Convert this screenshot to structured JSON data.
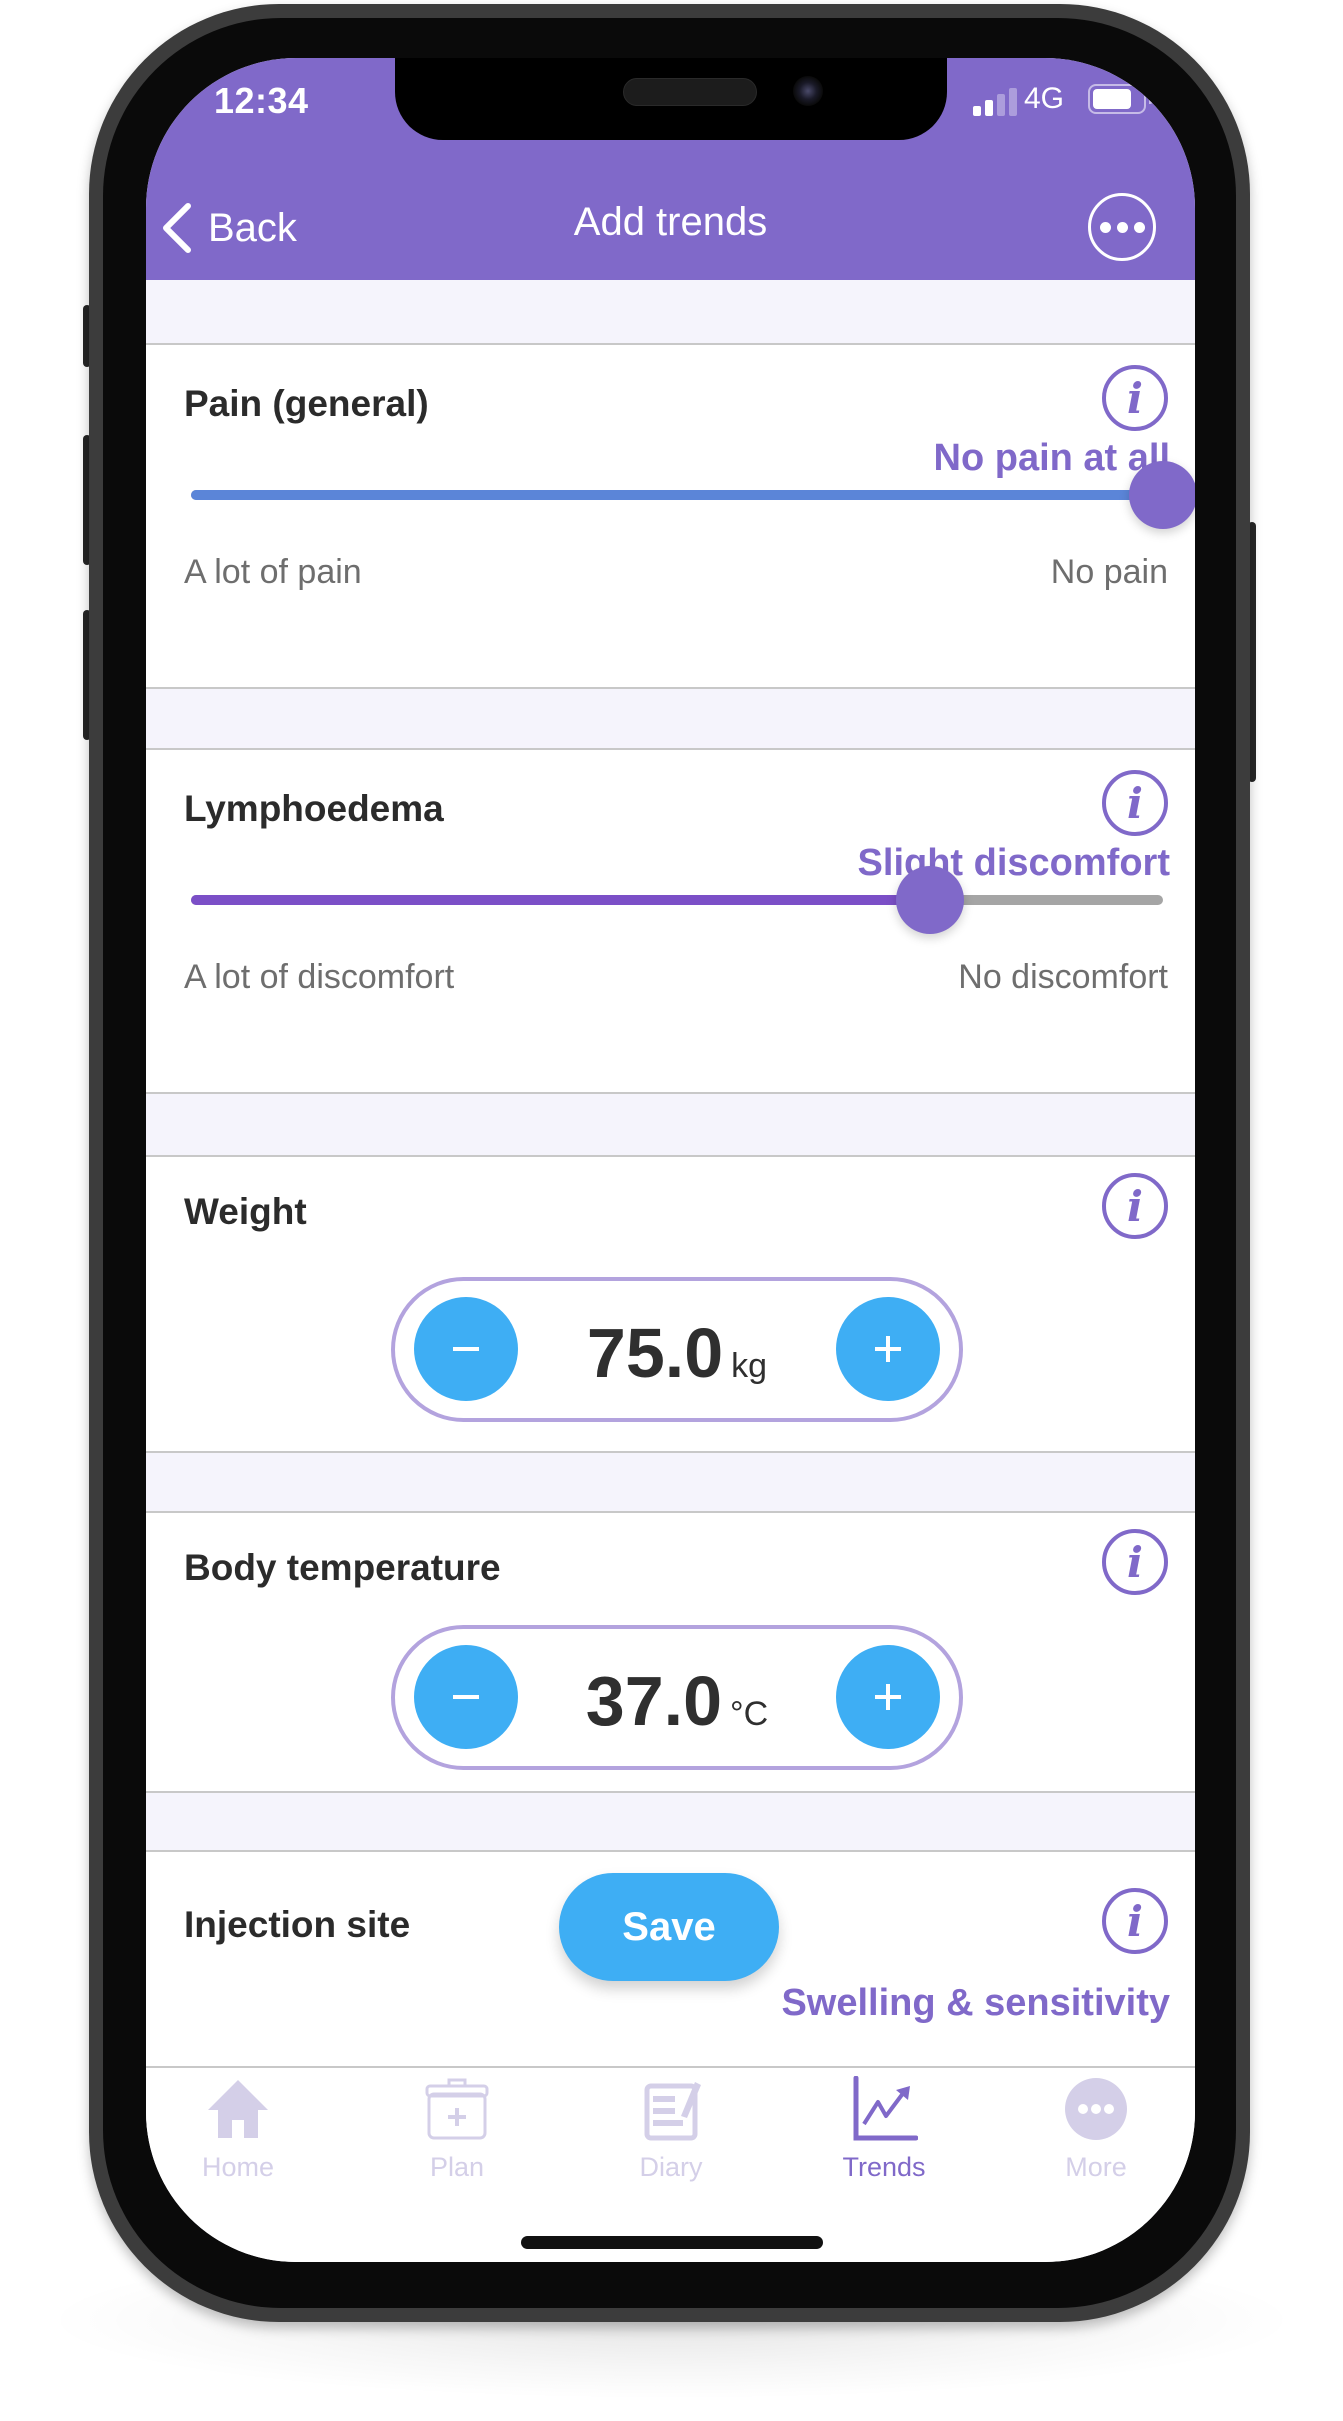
{
  "status_bar": {
    "time": "12:34",
    "network": "4G",
    "signal_bars_active": 2,
    "signal_bars_total": 4,
    "battery_level": 0.8
  },
  "nav": {
    "back_label": "Back",
    "title": "Add trends",
    "more_icon": "ellipsis-circle-icon"
  },
  "colors": {
    "brand_purple": "#8069c9",
    "accent_blue": "#3eaef4",
    "slider_blue": "#5b85d8",
    "slider_purple": "#7b4fc7",
    "inactive_tab": "#d4cfe8"
  },
  "trends": [
    {
      "title": "Pain (general)",
      "type": "slider",
      "value_label": "No pain at all",
      "min_label": "A lot of pain",
      "max_label": "No pain",
      "value_fraction": 1.0
    },
    {
      "title": "Lymphoedema",
      "type": "slider",
      "value_label": "Slight discomfort",
      "min_label": "A lot of discomfort",
      "max_label": "No discomfort",
      "value_fraction": 0.76
    },
    {
      "title": "Weight",
      "type": "stepper",
      "value": "75.0",
      "unit": "kg"
    },
    {
      "title": "Body temperature",
      "type": "stepper",
      "value": "37.0",
      "unit": "°C"
    },
    {
      "title": "Injection site",
      "type": "select",
      "value_label": "Swelling & sensitivity"
    }
  ],
  "save_label": "Save",
  "tabs": [
    {
      "label": "Home",
      "icon": "home-icon",
      "active": false
    },
    {
      "label": "Plan",
      "icon": "medical-plan-icon",
      "active": false
    },
    {
      "label": "Diary",
      "icon": "diary-icon",
      "active": false
    },
    {
      "label": "Trends",
      "icon": "trends-chart-icon",
      "active": true
    },
    {
      "label": "More",
      "icon": "more-icon",
      "active": false
    }
  ]
}
